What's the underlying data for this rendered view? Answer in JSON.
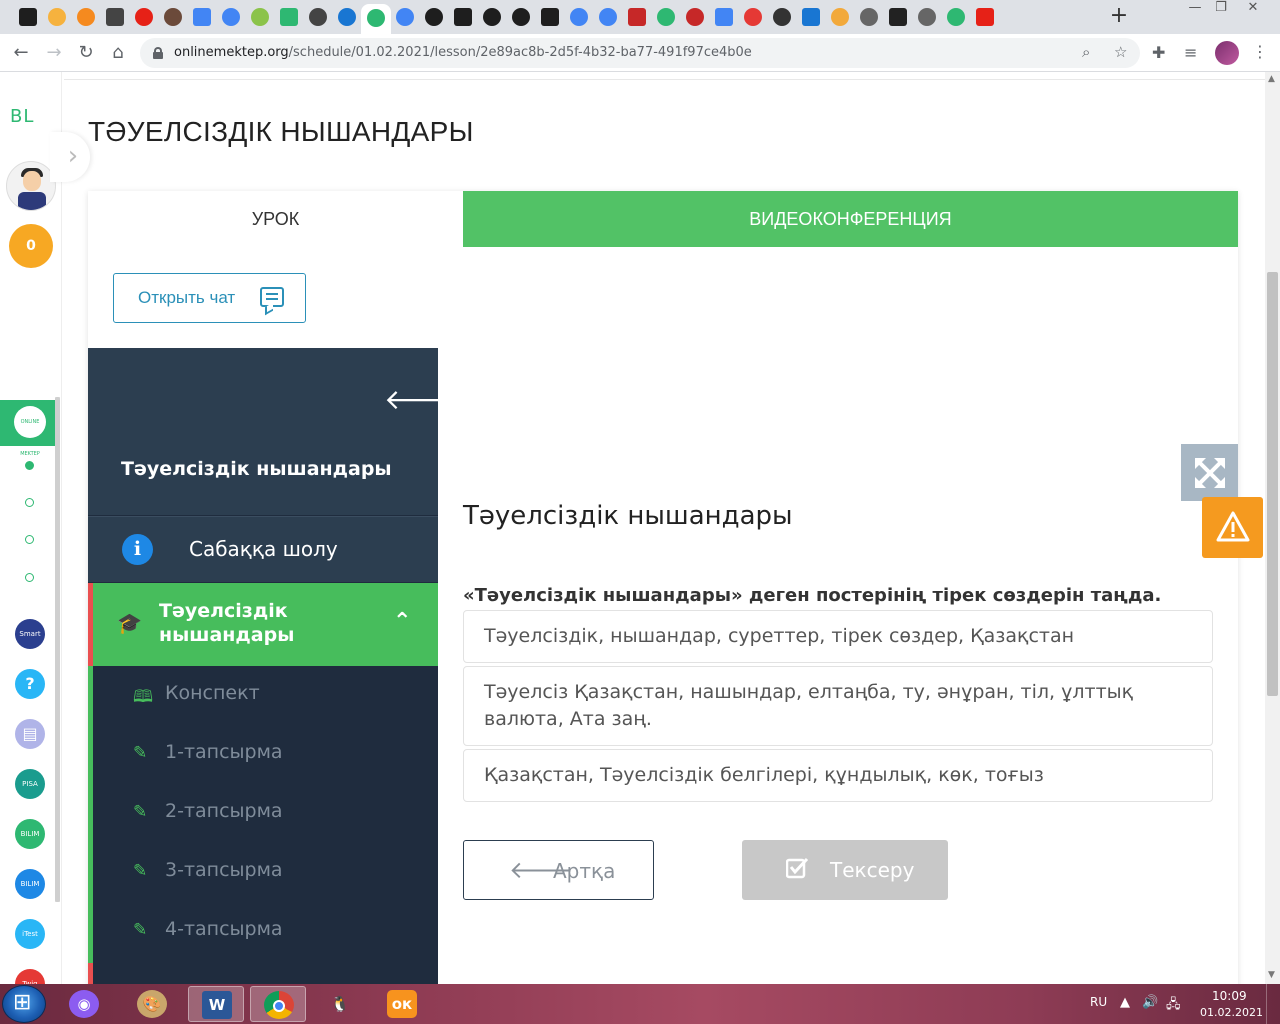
{
  "browser": {
    "url_host": "onlinemektep.org",
    "url_path": "/schedule/01.02.2021/lesson/2e89ac8b-2d5f-4b32-ba77-491f97ce4b0e",
    "tab_favicon_colors": [
      "#1e1e1e",
      "#f6b23e",
      "#f58a1f",
      "#444444",
      "#e62117",
      "#6b4a3a",
      "#4285f4",
      "#4285f4",
      "#8bc34a",
      "#2eb872",
      "#444444",
      "#1976d2",
      "#4285f4",
      "#4285f4",
      "#1e1e1e",
      "#1e1e1e",
      "#1e1e1e",
      "#1e1e1e",
      "#1e1e1e",
      "#4285f4",
      "#4285f4",
      "#c62828",
      "#2eb872",
      "#c62828",
      "#4285f4",
      "#e53935",
      "#333333",
      "#1976d2",
      "#f2a93b",
      "#666666",
      "#222222",
      "#666666",
      "#2eb872",
      "#e62117"
    ],
    "new_tab_label": "+"
  },
  "rail": {
    "brand": "BL",
    "coins": "0",
    "online_icon_text": "ONLINE MEKTEP",
    "apps": [
      {
        "label": "Smart Nation",
        "color": "#2b3f8f"
      },
      {
        "label": "?",
        "color": "#29b6f6"
      },
      {
        "label": "▤",
        "color": "#b0b4e8"
      },
      {
        "label": "PISA",
        "color": "#1a9c8e"
      },
      {
        "label": "BILIM Land",
        "color": "#2eb872"
      },
      {
        "label": "BILIM Book",
        "color": "#1e88e5"
      },
      {
        "label": "iTest",
        "color": "#29b6f6"
      },
      {
        "label": "Twig",
        "color": "#e53935"
      }
    ]
  },
  "page": {
    "heading": "ТӘУЕЛСІЗДІК НЫШАНДАРЫ"
  },
  "tabs": {
    "lesson": "УРОК",
    "video": "ВИДЕОКОНФЕРЕНЦИЯ"
  },
  "chat": {
    "open_label": "Открыть чат"
  },
  "sidebar": {
    "title": "Тәуелсіздік нышандары",
    "overview": "Сабаққа шолу",
    "active_section": "Тәуелсіздік нышандары",
    "items": [
      {
        "label": "Конспект",
        "icon": "book-icon"
      },
      {
        "label": "1-тапсырма",
        "icon": "edit-icon"
      },
      {
        "label": "2-тапсырма",
        "icon": "edit-icon"
      },
      {
        "label": "3-тапсырма",
        "icon": "edit-icon"
      },
      {
        "label": "4-тапсырма",
        "icon": "edit-icon"
      }
    ]
  },
  "content": {
    "title": "Тәуелсіздік нышандары",
    "question": "«Тәуелсіздік нышандары» деген постерінің тірек сөздерін таңда.",
    "options": [
      "Тәуелсіздік, нышандар, суреттер, тірек сөздер, Қазақстан",
      "Тәуелсіз Қазақстан, нашындар, елтаңба, ту, әнұран, тіл, ұлттық валюта, Ата заң.",
      "Қазақстан, Тәуелсіздік белгілері, құндылық, көк, тоғыз"
    ],
    "back_label": "Артқа",
    "check_label": "Тексеру"
  },
  "taskbar": {
    "lang": "RU",
    "time": "10:09",
    "date": "01.02.2021"
  },
  "colors": {
    "accent_green": "#52c266",
    "sidebar_dark": "#1f2c3e",
    "warning": "#f59a1f",
    "link_blue": "#2b90b8"
  }
}
